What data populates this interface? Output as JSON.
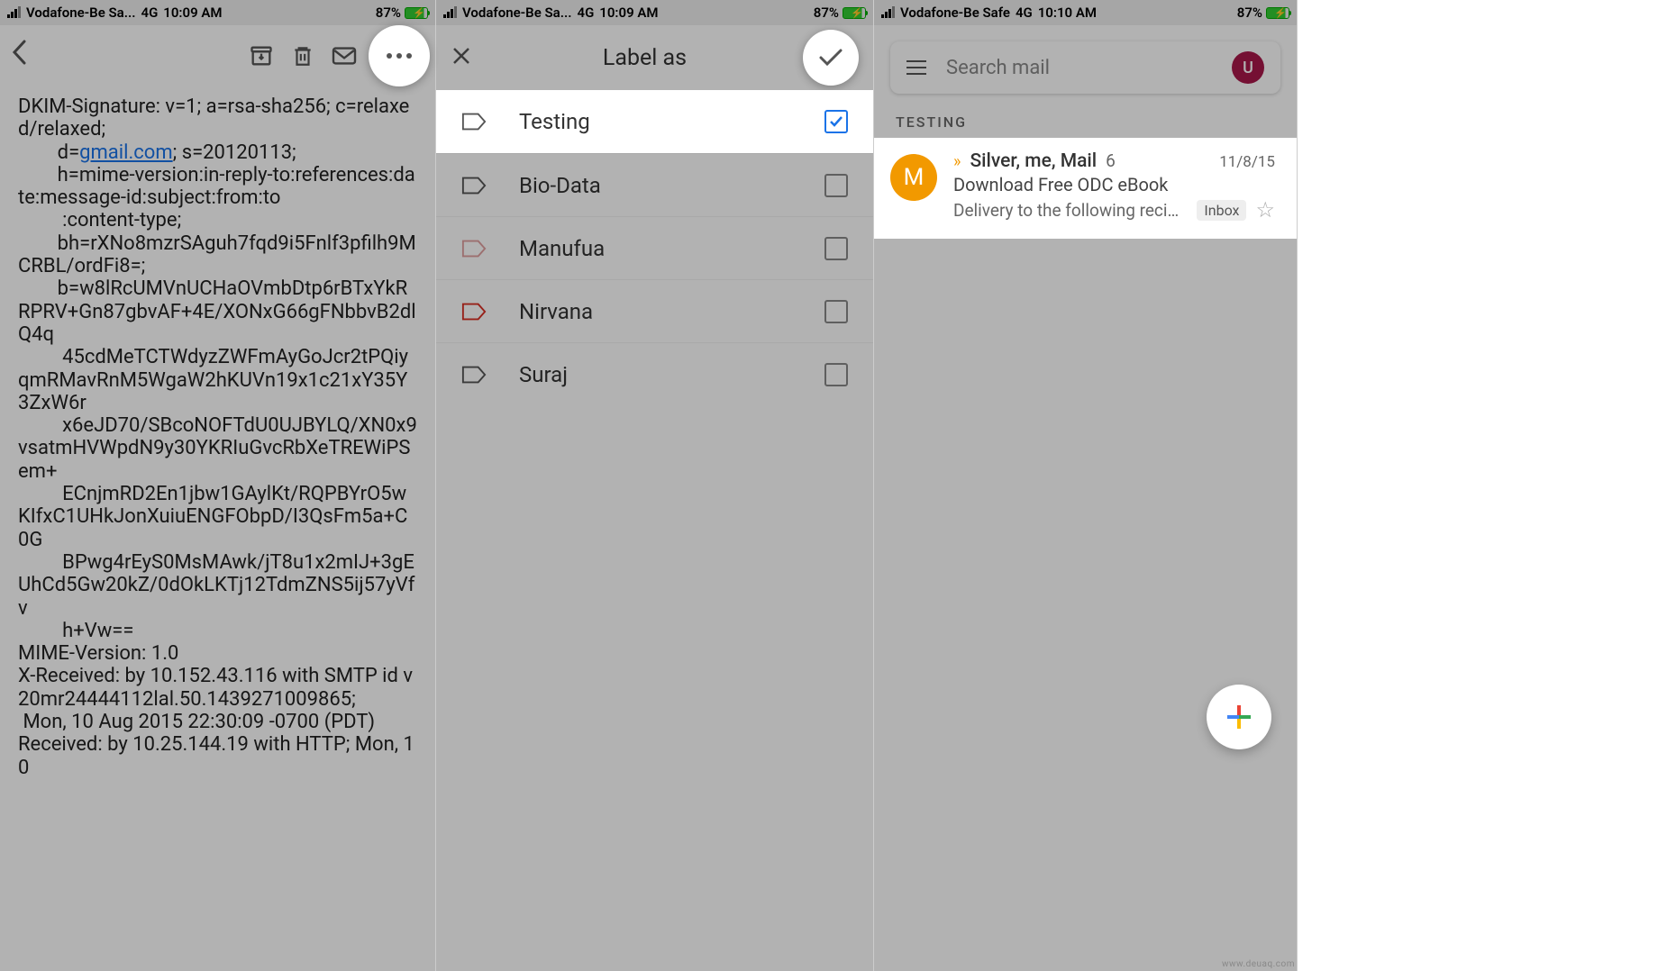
{
  "status": {
    "carrier_short": "Vodafone-Be Sa...",
    "carrier_full": "Vodafone-Be Safe",
    "network": "4G",
    "time_a": "10:09 AM",
    "time_b": "10:10 AM",
    "battery_pct": "87%"
  },
  "screen1": {
    "email_body_html": "DKIM-Signature: v=1; a=rsa-sha256; c=relaxed/relaxed;\n        d=<a href='#'>gmail.com</a>; s=20120113;\n        h=mime-version:in-reply-to:references:date:message-id:subject:from:to\n         :content-type;\n        bh=rXNo8mzrSAguh7fqd9i5Fnlf3pfilh9MCRBL/ordFi8=;\n        b=w8lRcUMVnUCHaOVmbDtp6rBTxYkRRPRV+Gn87gbvAF+4E/XONxG66gFNbbvB2dlQ4q\n         45cdMeTCTWdyzZWFmAyGoJcr2tPQiyqmRMavRnM5WgaW2hKUVn19x1c21xY35Y3ZxW6r\n         x6eJD70/SBcoNOFTdU0UJBYLQ/XN0x9vsatmHVWpdN9y30YKRIuGvcRbXeTREWiPSem+\n         ECnjmRD2En1jbw1GAylKt/RQPBYrO5wKIfxC1UHkJonXuiuENGFObpD/I3QsFm5a+C0G\n         BPwg4rEyS0MsMAwk/jT8u1x2mIJ+3gEUhCd5Gw20kZ/0dOkLKTj12TdmZNS5ij57yVfv\n         h+Vw==\nMIME-Version: 1.0\nX-Received: by 10.152.43.116 with SMTP id v20mr24444112lal.50.1439271009865;\n Mon, 10 Aug 2015 22:30:09 -0700 (PDT)\nReceived: by 10.25.144.19 with HTTP; Mon, 10"
  },
  "screen2": {
    "title": "Label as",
    "labels": [
      {
        "name": "Testing",
        "color": "#555",
        "checked": true
      },
      {
        "name": "Bio-Data",
        "color": "#555",
        "checked": false
      },
      {
        "name": "Manufua",
        "color": "#e0a0a0",
        "checked": false
      },
      {
        "name": "Nirvana",
        "color": "#d93025",
        "checked": false
      },
      {
        "name": "Suraj",
        "color": "#555",
        "checked": false
      }
    ]
  },
  "screen3": {
    "search_placeholder": "Search mail",
    "avatar_letter": "U",
    "section": "TESTING",
    "email": {
      "avatar_letter": "M",
      "senders": "Silver, me, Mail",
      "count": "6",
      "date": "11/8/15",
      "subject": "Download Free ODC eBook",
      "snippet": "Delivery to the following recipie...",
      "badge": "Inbox"
    }
  },
  "watermark": "www.deuaq.com"
}
